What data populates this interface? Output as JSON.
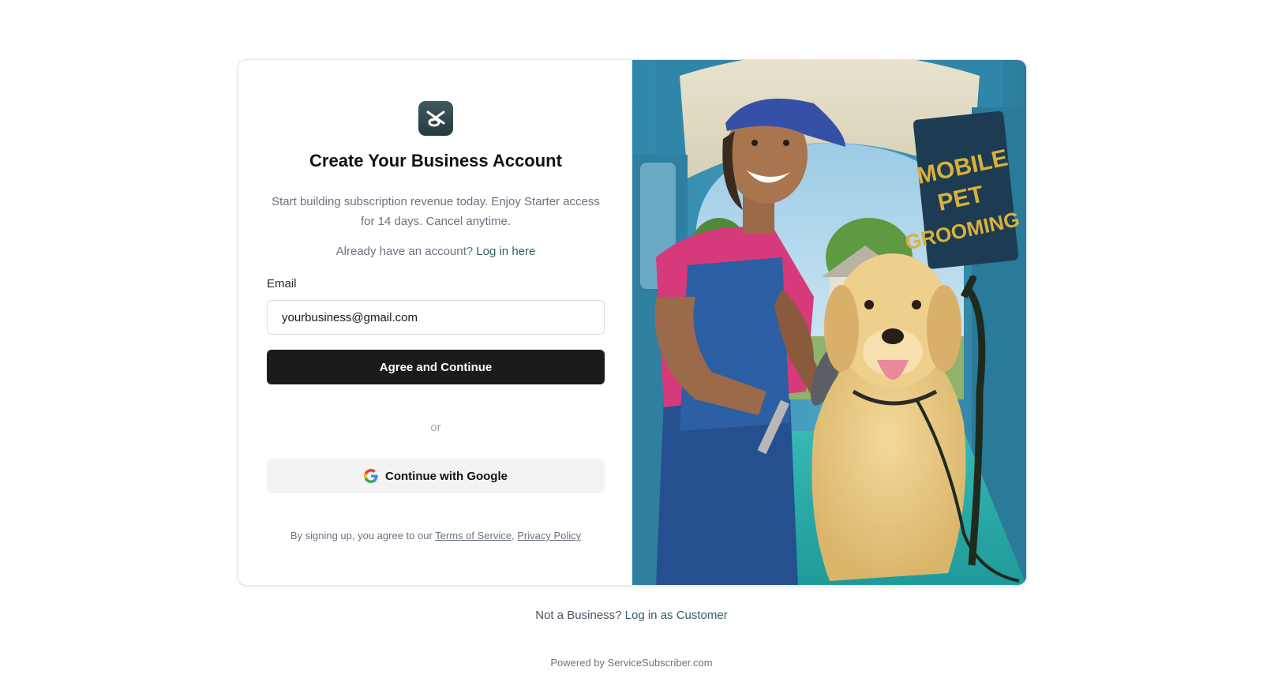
{
  "signup": {
    "title": "Create Your Business Account",
    "subtitle": "Start building subscription revenue today. Enjoy Starter access for 14 days. Cancel anytime.",
    "login_prompt": "Already have an account?",
    "login_link": "Log in here",
    "email_label": "Email",
    "email_value": "yourbusiness@gmail.com",
    "primary_button": "Agree and Continue",
    "divider": "or",
    "google_button": "Continue with Google",
    "terms_prefix": "By signing up, you agree to our",
    "terms_link": "Terms of Service",
    "terms_separator": ",",
    "privacy_link": "Privacy Policy"
  },
  "hero": {
    "sign_text": [
      "MOBILE",
      "PET",
      "GROOMING"
    ],
    "colors": {
      "van_blue": "#3b8fb0",
      "floor_teal": "#2fb3b0",
      "shirt_pink": "#d63a7a",
      "sign_yellow": "#d9b13a"
    }
  },
  "footer": {
    "not_business": "Not a Business?",
    "customer_link": "Log in as Customer",
    "powered_by": "Powered by ServiceSubscriber.com"
  },
  "theme": {
    "brand_dark": "#1b1b1d",
    "link_teal": "#2f5f6a",
    "logo_bg": "#2f4a50"
  }
}
